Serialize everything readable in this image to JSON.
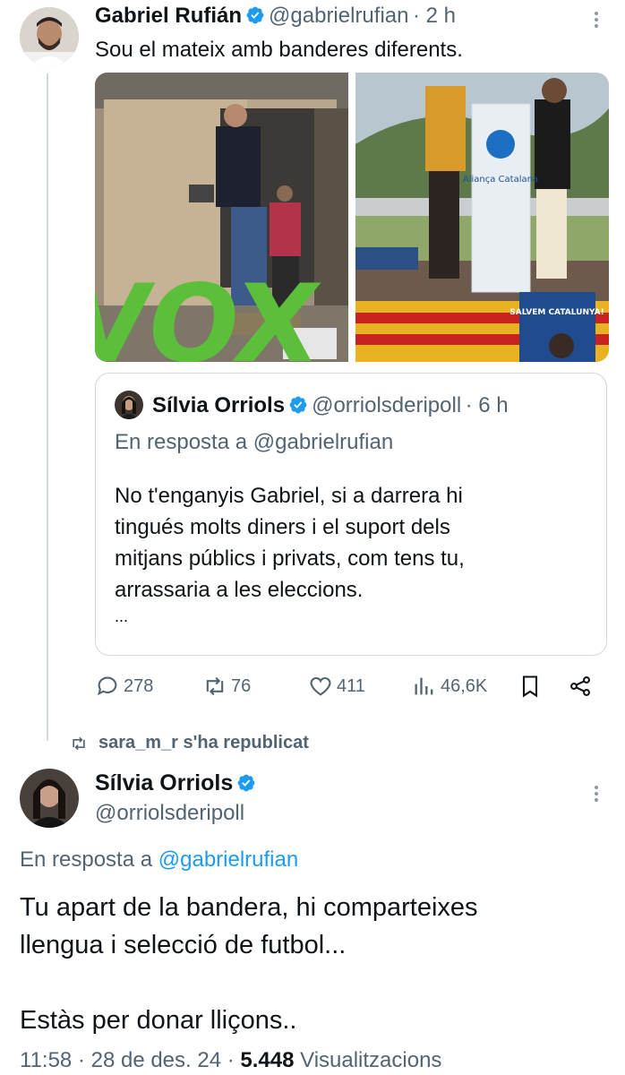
{
  "tweet1": {
    "name": "Gabriel Rufián",
    "handle": "@gabrielrufian",
    "time": "· 2 h",
    "text": "Sou el mateix amb banderes diferents.",
    "images": {
      "left_sign": "VOX",
      "right_podium": "Aliança Catalana",
      "right_banner": "SALVEM CATALUNYA!"
    },
    "quote": {
      "name": "Sílvia Orriols",
      "handle": "@orriolsderipoll",
      "time": "· 6 h",
      "reply_prefix": "En resposta a",
      "reply_handle": "@gabrielrufian",
      "text_lines": [
        "No t'enganyis Gabriel, si a darrera hi",
        "tingués molts diners i el suport dels",
        "mitjans públics i privats, com tens tu,",
        "arrassaria a les eleccions."
      ],
      "ellipsis": "..."
    },
    "actions": {
      "replies": "278",
      "retweets": "76",
      "likes": "411",
      "views": "46,6K"
    }
  },
  "repost_label": "sara_m_r s'ha republicat",
  "tweet2": {
    "name": "Sílvia Orriols",
    "handle": "@orriolsderipoll",
    "reply_prefix": "En resposta a",
    "reply_handle": "@gabrielrufian",
    "lines": [
      "Tu apart de la bandera, hi comparteixes",
      "llengua i selecció de futbol...",
      "",
      "Estàs per donar lliçons.."
    ],
    "time": "11:58 · 28 de des. 24 ·",
    "views_count": "5.448",
    "views_label": "Visualitzacions"
  },
  "colors": {
    "accent": "#1d9bf0",
    "secondary_text": "#536471",
    "border": "#cfd9de",
    "vox_green": "#5bbf3a"
  }
}
